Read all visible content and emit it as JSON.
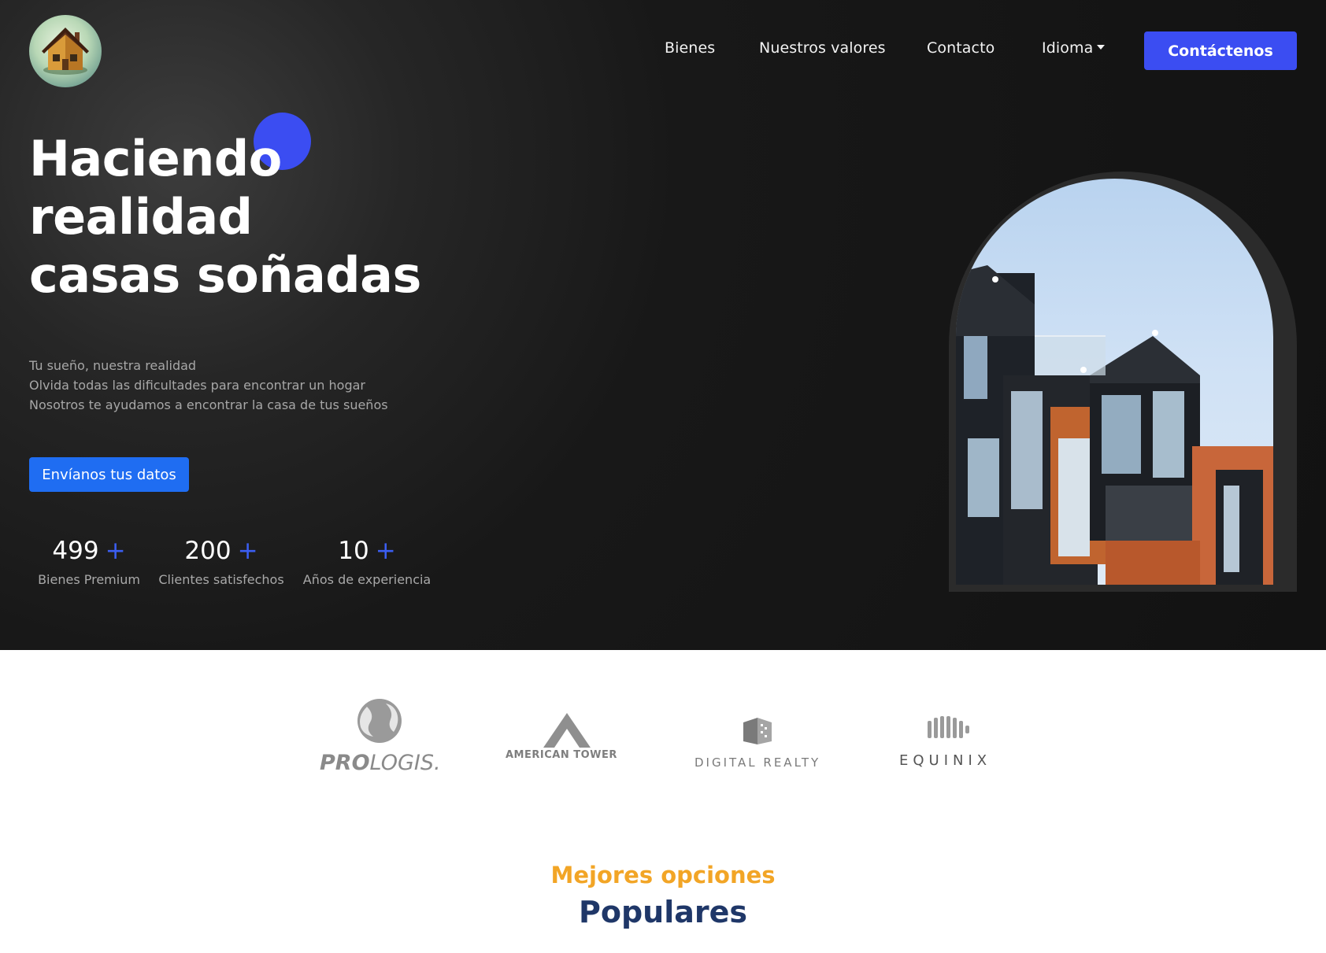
{
  "nav": {
    "logo_icon": "house-logo-icon",
    "items": [
      {
        "label": "Bienes"
      },
      {
        "label": "Nuestros valores"
      },
      {
        "label": "Contacto"
      },
      {
        "label": "Idioma"
      }
    ],
    "cta_label": "Contáctenos"
  },
  "hero": {
    "title_lines": [
      "Haciendo",
      "realidad",
      "casas soñadas"
    ],
    "text_lines": [
      "Tu sueño, nuestra realidad",
      "Olvida todas las dificultades para encontrar un hogar",
      "Nosotros te ayudamos a encontrar la casa de tus sueños"
    ],
    "button_label": "Envíanos tus datos",
    "stats": [
      {
        "value": "499",
        "plus": "+",
        "label": "Bienes Premium"
      },
      {
        "value": "200",
        "plus": "+",
        "label": "Clientes satisfechos"
      },
      {
        "value": "10",
        "plus": "+",
        "label": "Años de experiencia"
      }
    ],
    "image": "modern-building-photo"
  },
  "brands": [
    {
      "name": "PROLOGIS",
      "prefix": "PRO",
      "suffix": "LOGIS."
    },
    {
      "name": "AMERICAN TOWER"
    },
    {
      "name": "DIGITAL REALTY"
    },
    {
      "name": "EQUINIX"
    }
  ],
  "section": {
    "subtitle": "Mejores opciones",
    "title": "Populares"
  },
  "colors": {
    "accent_blue": "#3b4df2",
    "button_blue": "#1f6df2",
    "subtitle_orange": "#f2a526",
    "title_navy": "#1f3768",
    "hero_background": "#141414"
  }
}
